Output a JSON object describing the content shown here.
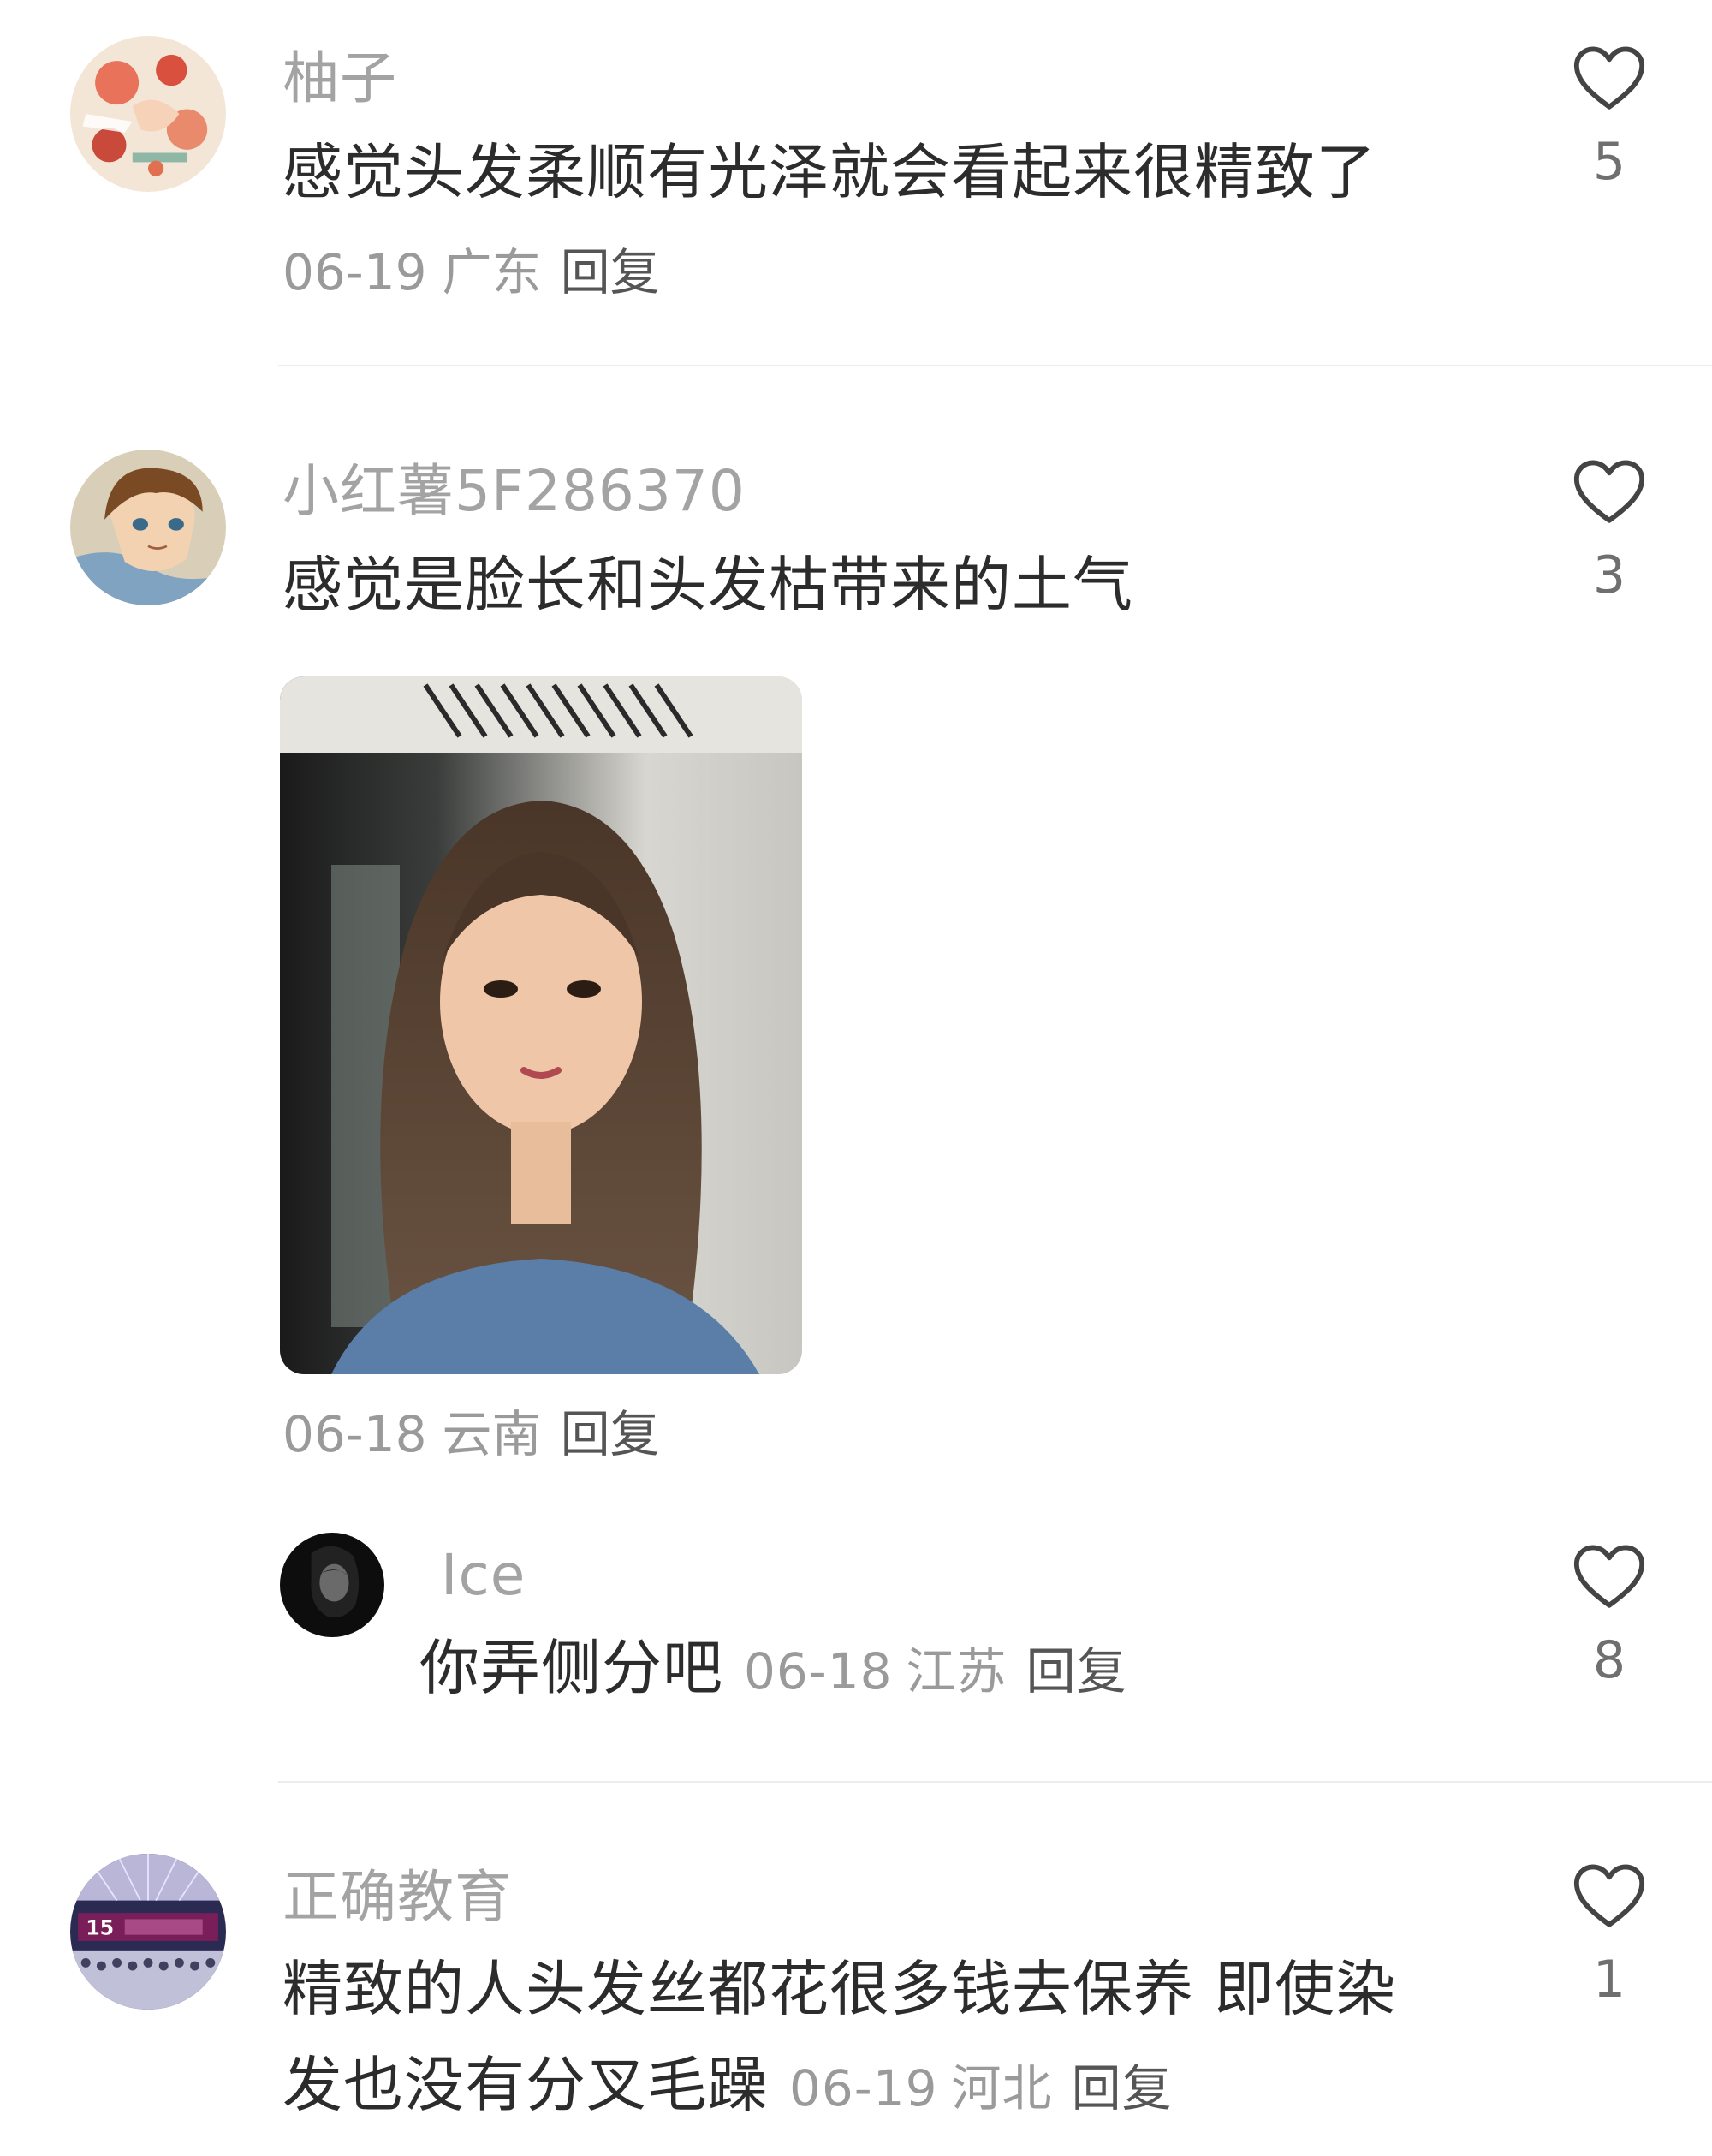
{
  "comments": [
    {
      "username": "柚子",
      "text": "感觉头发柔顺有光泽就会看起来很精致了",
      "date": "06-19",
      "location": "广东",
      "reply_label": "回复",
      "likes": "5",
      "avatar_icon": "floral-illustration-avatar"
    },
    {
      "username": "小红薯5F286370",
      "text": "感觉是脸长和头发枯带来的土气",
      "date": "06-18",
      "location": "云南",
      "reply_label": "回复",
      "likes": "3",
      "avatar_icon": "anime-boy-avatar",
      "has_photo": true,
      "replies": [
        {
          "username": "Ice",
          "text": "你弄侧分吧",
          "date": "06-18",
          "location": "江苏",
          "reply_label": "回复",
          "likes": "8",
          "avatar_icon": "dark-portrait-avatar"
        }
      ]
    },
    {
      "username": "正确教育",
      "text_line1": "精致的人头发丝都花很多钱去保养 即使染",
      "text_line2": "发也没有分叉毛躁",
      "date": "06-19",
      "location": "河北",
      "reply_label": "回复",
      "likes": "1",
      "avatar_icon": "event-stage-avatar"
    }
  ],
  "colors": {
    "username": "#a3a3a3",
    "text": "#2c2c2c",
    "meta": "#9a9a9a",
    "heart_outline": "#444444",
    "divider": "#ececec"
  }
}
